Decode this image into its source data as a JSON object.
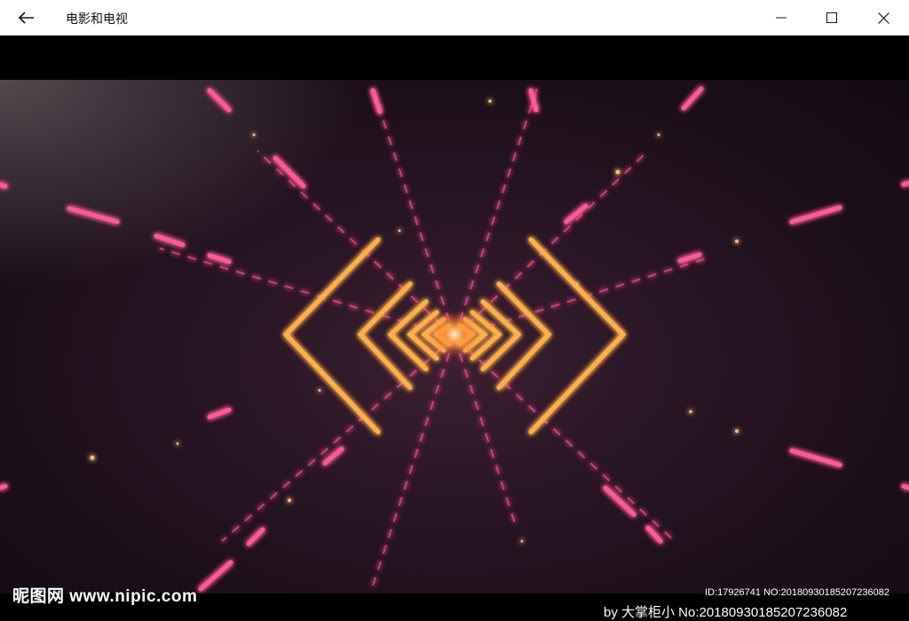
{
  "window": {
    "title": "电影和电视",
    "back_icon": "arrow-left-icon",
    "minimize_icon": "minimize-icon",
    "maximize_icon": "maximize-icon",
    "close_icon": "close-icon"
  },
  "video": {
    "description_colors": {
      "glow_orange": "#ffb04a",
      "glow_pink": "#ff4f8f",
      "background": "#1c0f19"
    }
  },
  "watermark": {
    "logo_text": "昵图网 www.nipic.com",
    "id_text": "ID:17926741 NO:20180930185207236082",
    "cut_text": "by 大掌柜小 No:20180930185207236082"
  }
}
